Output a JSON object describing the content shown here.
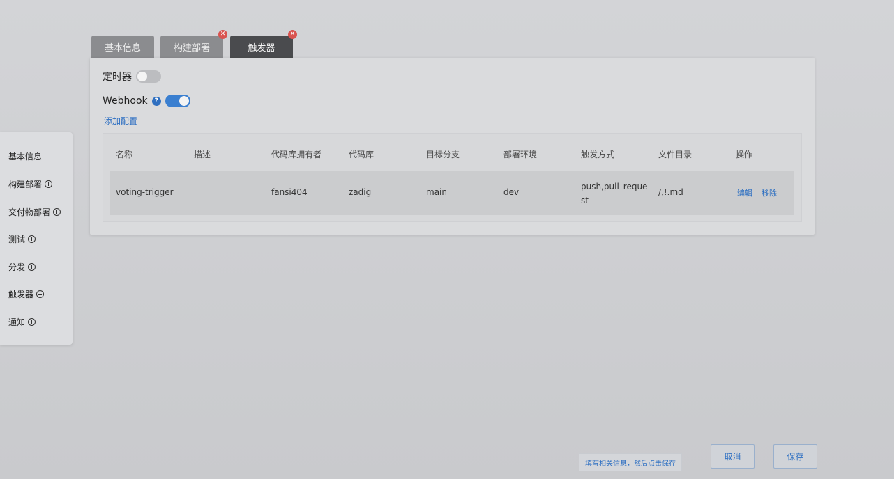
{
  "tabs": [
    {
      "label": "基本信息",
      "closable": false
    },
    {
      "label": "构建部署",
      "closable": true
    },
    {
      "label": "触发器",
      "closable": true,
      "active": true
    }
  ],
  "timer": {
    "label": "定时器",
    "enabled": false
  },
  "webhook": {
    "label": "Webhook",
    "help_icon": "?",
    "enabled": true
  },
  "add_config_label": "添加配置",
  "table": {
    "headers": [
      "名称",
      "描述",
      "代码库拥有者",
      "代码库",
      "目标分支",
      "部署环境",
      "触发方式",
      "文件目录",
      "操作"
    ],
    "rows": [
      {
        "name": "voting-trigger",
        "desc": "",
        "owner": "fansi404",
        "repo": "zadig",
        "branch": "main",
        "env": "dev",
        "trigger": "push,pull_request",
        "files": "/,!.md",
        "edit_label": "编辑",
        "remove_label": "移除"
      }
    ]
  },
  "sidebar": {
    "items": [
      {
        "label": "基本信息",
        "has_add": false
      },
      {
        "label": "构建部署",
        "has_add": true
      },
      {
        "label": "交付物部署",
        "has_add": true
      },
      {
        "label": "测试",
        "has_add": true
      },
      {
        "label": "分发",
        "has_add": true
      },
      {
        "label": "触发器",
        "has_add": true
      },
      {
        "label": "通知",
        "has_add": true
      }
    ]
  },
  "footer": {
    "hint": "填写相关信息，然后点击保存",
    "cancel_label": "取消",
    "save_label": "保存"
  },
  "colors": {
    "accent": "#2d6fc2",
    "close_badge": "#d9534f",
    "switch_on": "#3a7fd0"
  }
}
